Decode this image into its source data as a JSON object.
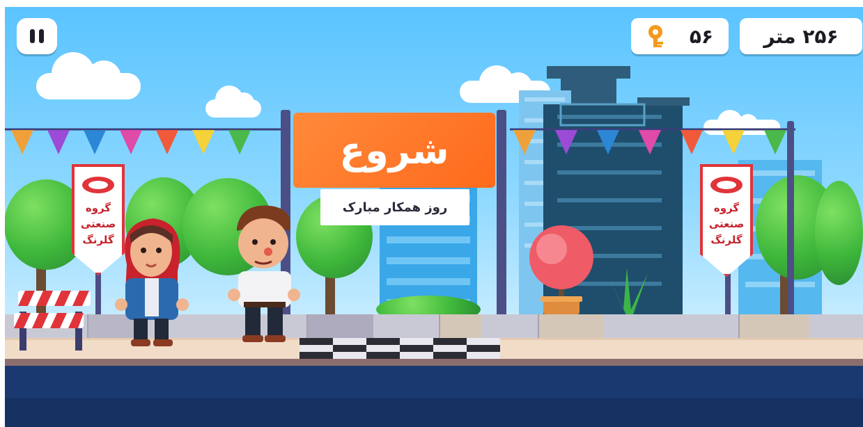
{
  "hud": {
    "distance_label": "۲۵۶ متر",
    "keys_count": "۵۶",
    "key_icon": "key-icon",
    "pause_icon": "pause-icon"
  },
  "scene": {
    "start_sign": "شروع",
    "start_subtitle": "روز همکار مبارک",
    "left_banner_lines": [
      "گروه",
      "صنعتی",
      "گلرنگ"
    ],
    "right_banner_lines": [
      "گروه",
      "صنعتی",
      "گلرنگ"
    ]
  },
  "colors": {
    "sky": "#58c3ff",
    "sign_orange": "#ff6a1c",
    "banner_red": "#e0343a",
    "road_blue": "#1a3970",
    "key_orange": "#f39a1d"
  }
}
